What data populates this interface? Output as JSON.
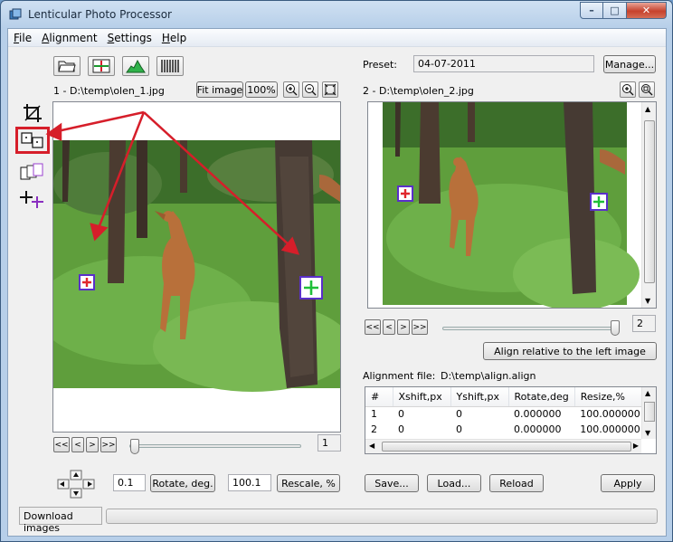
{
  "window": {
    "title": "Lenticular Photo Processor",
    "buttons": {
      "minimize": "–",
      "maximize": "□",
      "close": "✕"
    }
  },
  "menu": [
    {
      "label": "File",
      "key": "F",
      "rest": "ile"
    },
    {
      "label": "Alignment",
      "key": "A",
      "rest": "lignment"
    },
    {
      "label": "Settings",
      "key": "S",
      "rest": "ettings"
    },
    {
      "label": "Help",
      "key": "H",
      "rest": "elp"
    }
  ],
  "toolbar": {
    "icons": [
      "open-folder-icon",
      "crosshair-image-icon",
      "histogram-icon",
      "lenticular-stripes-icon"
    ]
  },
  "left_tools": [
    "crop-icon",
    "align-boxes-icon",
    "stack-layers-icon",
    "add-marker-icon"
  ],
  "left_image": {
    "caption": "1 - D:\\temp\\olen_1.jpg",
    "fit_label": "Fit image",
    "zoom_label": "100%",
    "frame_value": "1"
  },
  "right_image": {
    "caption": "2 - D:\\temp\\olen_2.jpg",
    "frame_value": "2"
  },
  "preset": {
    "label": "Preset:",
    "value": "04-07-2011",
    "manage_label": "Manage..."
  },
  "nav": {
    "first": "<<",
    "prev": "<",
    "next": ">",
    "last": ">>"
  },
  "align_left_label": "Align relative to the left image",
  "alignment_file": {
    "label": "Alignment file:",
    "value": "D:\\temp\\align.align"
  },
  "table": {
    "headers": [
      "#",
      "Xshift,px",
      "Yshift,px",
      "Rotate,deg",
      "Resize,%"
    ],
    "rows": [
      [
        "1",
        "0",
        "0",
        "0.000000",
        "100.000000"
      ],
      [
        "2",
        "0",
        "0",
        "0.000000",
        "100.000000"
      ]
    ]
  },
  "controls": {
    "rotate_value": "0.1",
    "rotate_label": "Rotate, deg.",
    "rescale_value": "100.1",
    "rescale_label": "Rescale, %"
  },
  "actions": {
    "save": "Save...",
    "load": "Load...",
    "reload": "Reload",
    "apply": "Apply"
  },
  "status": {
    "text": "Download images",
    "progress": 0
  },
  "colors": {
    "annotation_red": "#d61e2a",
    "marker_border": "#5a2fc9",
    "marker_red": "#e0262d",
    "marker_green": "#1fbf3a"
  }
}
